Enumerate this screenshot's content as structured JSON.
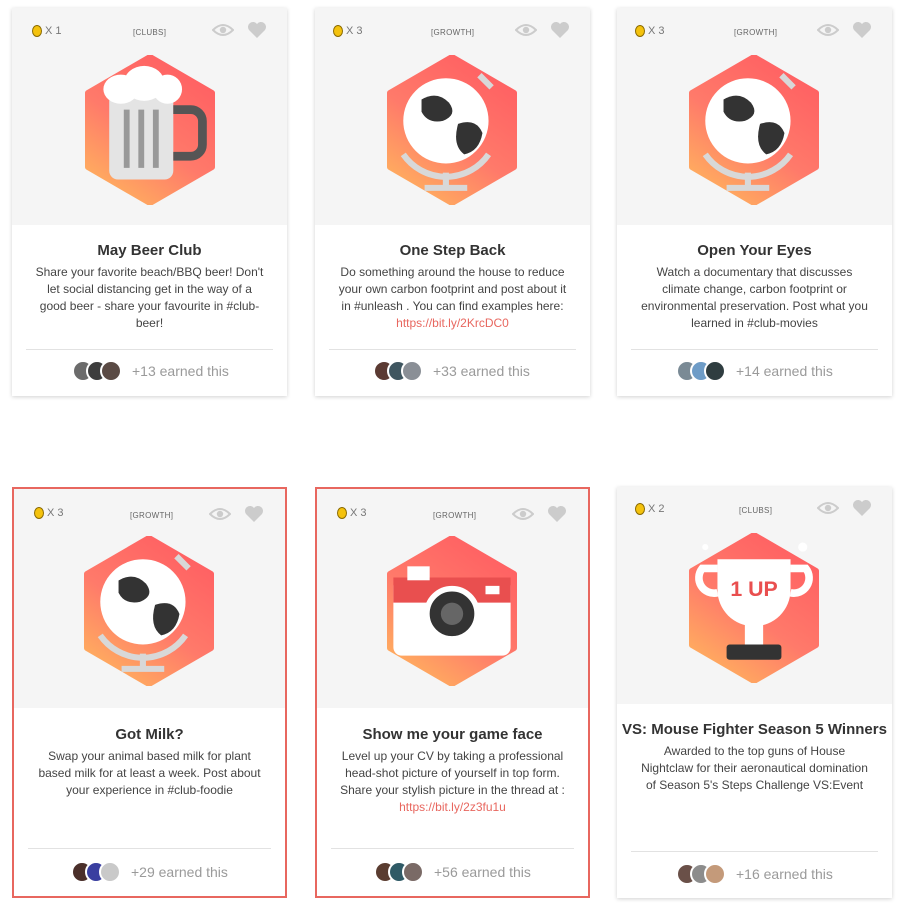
{
  "colors": {
    "accent": "#e8675f",
    "link": "#e8675f",
    "hex_top": "#ff5e62",
    "hex_bottom": "#ffb25e"
  },
  "cards": [
    {
      "coin_count": "X 1",
      "category": "[CLUBS]",
      "icon": "beer-mug-icon",
      "title": "May Beer Club",
      "desc": "Share your favorite beach/BBQ beer! Don't let social distancing get in the way of a good beer - share your favourite in #club-beer!",
      "link": "",
      "earned": "+13 earned this",
      "selected": false
    },
    {
      "coin_count": "X 3",
      "category": "[GROWTH]",
      "icon": "globe-icon",
      "title": "One Step Back",
      "desc": "Do something around the house to reduce your own carbon footprint and post about it in #unleash . You can find examples here:",
      "link": "https://bit.ly/2KrcDC0",
      "earned": "+33 earned this",
      "selected": false
    },
    {
      "coin_count": "X 3",
      "category": "[GROWTH]",
      "icon": "globe-icon",
      "title": "Open Your Eyes",
      "desc": "Watch a documentary that discusses climate change, carbon footprint or environmental preservation. Post what you learned in #club-movies",
      "link": "",
      "earned": "+14 earned this",
      "selected": false
    },
    {
      "coin_count": "X 3",
      "category": "[GROWTH]",
      "icon": "globe-icon",
      "title": "Got Milk?",
      "desc": "Swap your animal based milk for plant based milk for at least a week. Post about your experience in #club-foodie",
      "link": "",
      "earned": "+29 earned this",
      "selected": true
    },
    {
      "coin_count": "X 3",
      "category": "[GROWTH]",
      "icon": "camera-icon",
      "title": "Show me your game face",
      "desc": "Level up your CV by taking a professional head-shot picture of yourself in top form. Share your stylish picture in the thread at :",
      "link": "https://bit.ly/2z3fu1u",
      "earned": "+56 earned this",
      "selected": true
    },
    {
      "coin_count": "X 2",
      "category": "[CLUBS]",
      "icon": "trophy-icon",
      "trophy_text": "1 UP",
      "title": "VS: Mouse Fighter Season 5 Winners",
      "desc": "Awarded to the top guns of House Nightclaw for their aeronautical domination of Season 5's Steps Challenge VS:Event",
      "link": "",
      "earned": "+16 earned this",
      "selected": false
    }
  ]
}
